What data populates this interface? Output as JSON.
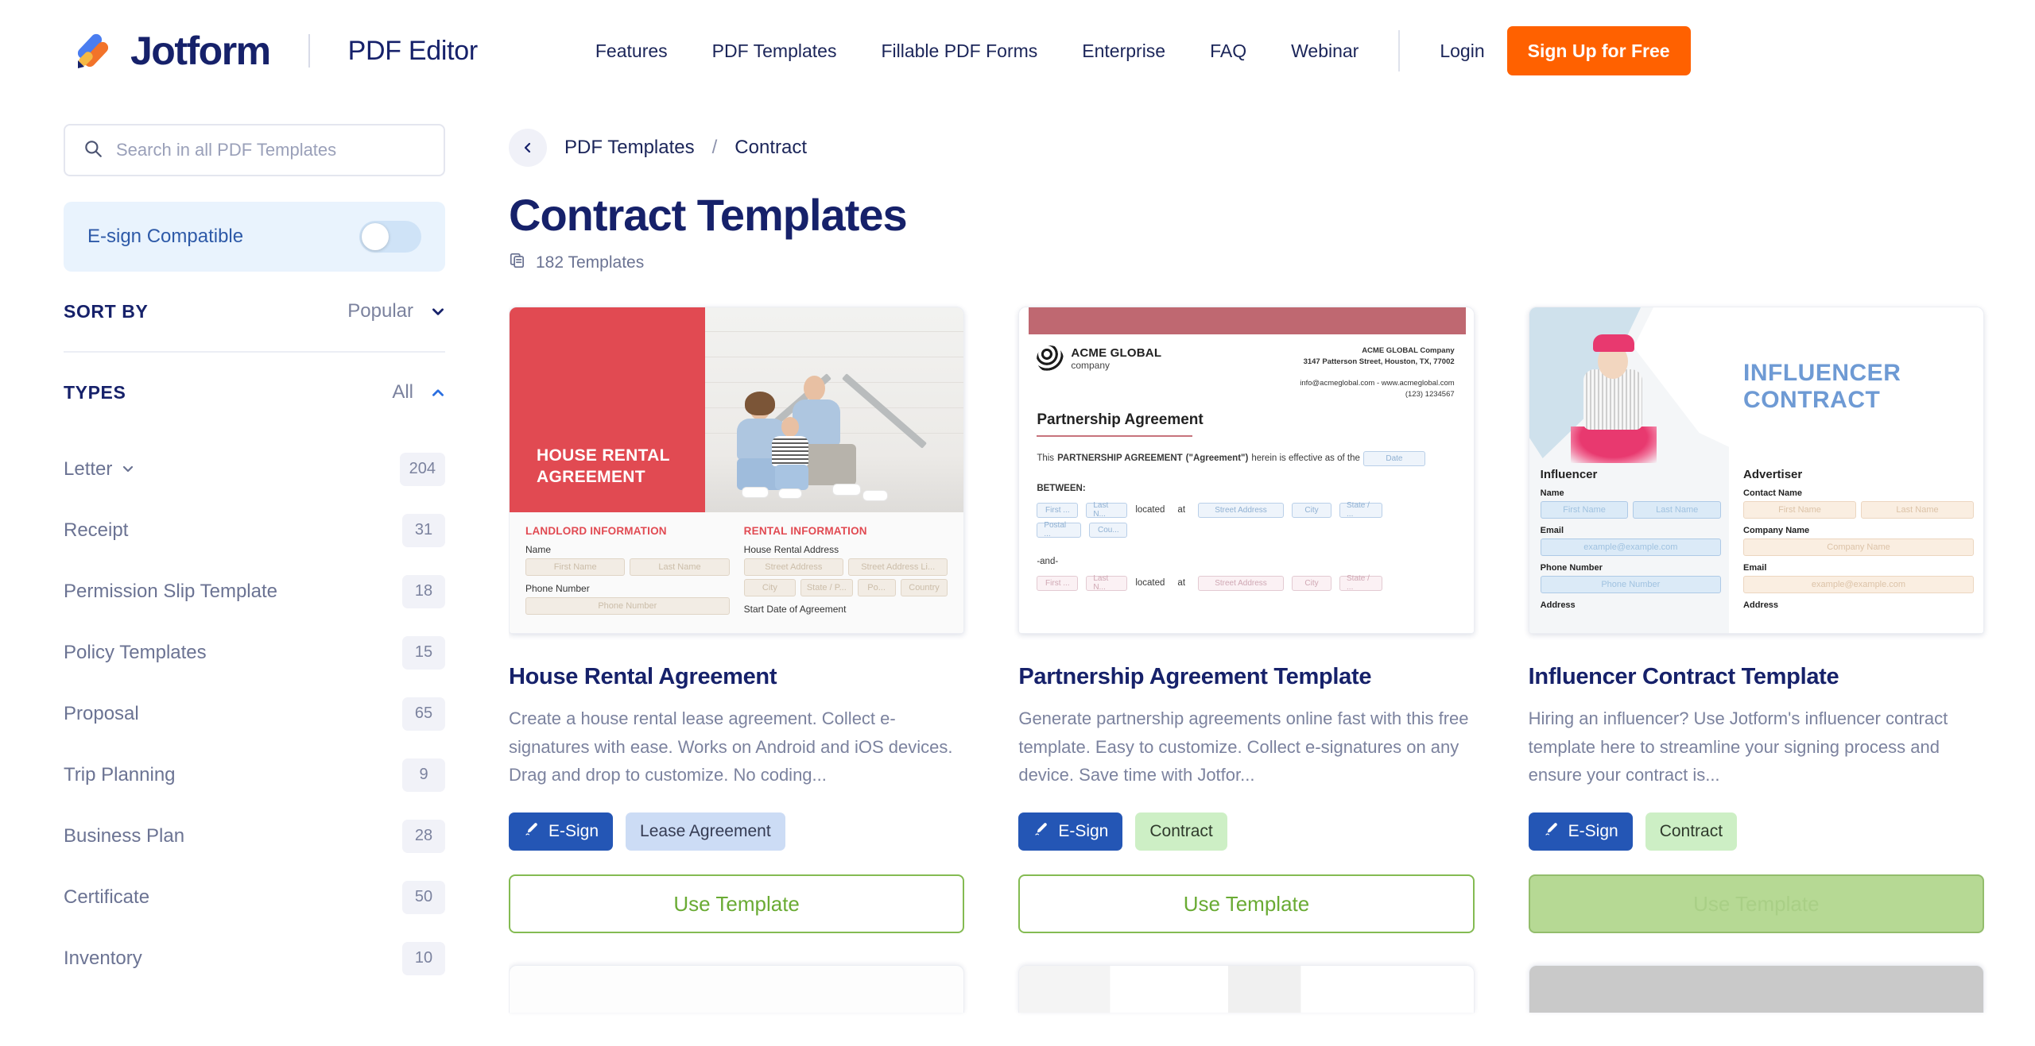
{
  "header": {
    "logo_text": "Jotform",
    "product_name": "PDF Editor",
    "nav": [
      {
        "label": "Features"
      },
      {
        "label": "PDF Templates"
      },
      {
        "label": "Fillable PDF Forms"
      },
      {
        "label": "Enterprise"
      },
      {
        "label": "FAQ"
      },
      {
        "label": "Webinar"
      }
    ],
    "login_label": "Login",
    "signup_label": "Sign Up for Free",
    "accent_orange": "#ff6100",
    "brand_navy": "#16216a"
  },
  "sidebar": {
    "search": {
      "placeholder": "Search in all PDF Templates",
      "value": ""
    },
    "esign": {
      "label": "E-sign Compatible",
      "enabled": false
    },
    "sort": {
      "title": "SORT BY",
      "value": "Popular"
    },
    "types": {
      "title": "TYPES",
      "value": "All"
    },
    "type_items": [
      {
        "label": "Letter",
        "count": "204",
        "has_caret": true
      },
      {
        "label": "Receipt",
        "count": "31",
        "has_caret": false
      },
      {
        "label": "Permission Slip Template",
        "count": "18",
        "has_caret": false
      },
      {
        "label": "Policy Templates",
        "count": "15",
        "has_caret": false
      },
      {
        "label": "Proposal",
        "count": "65",
        "has_caret": false
      },
      {
        "label": "Trip Planning",
        "count": "9",
        "has_caret": false
      },
      {
        "label": "Business Plan",
        "count": "28",
        "has_caret": false
      },
      {
        "label": "Certificate",
        "count": "50",
        "has_caret": false
      },
      {
        "label": "Inventory",
        "count": "10",
        "has_caret": false
      }
    ]
  },
  "main": {
    "breadcrumb": {
      "root": "PDF Templates",
      "separator": "/",
      "current": "Contract"
    },
    "title": "Contract Templates",
    "count_text": "182 Templates",
    "use_template_label": "Use Template",
    "esign_tag_label": "E-Sign",
    "cards": [
      {
        "title": "House Rental Agreement",
        "description": "Create a house rental lease agreement. Collect e-signatures with ease. Works on Android and iOS devices. Drag and drop to customize. No coding...",
        "tag": "Lease Agreement",
        "button_state": "normal",
        "thumb": {
          "hero_title": "HOUSE RENTAL AGREEMENT",
          "left_heading": "LANDLORD INFORMATION",
          "right_heading": "RENTAL INFORMATION",
          "left_fields": [
            {
              "label": "Name",
              "placeholders": [
                "First Name",
                "Last Name"
              ]
            },
            {
              "label": "Phone Number",
              "placeholders": [
                "Phone Number"
              ]
            }
          ],
          "right_fields": [
            {
              "label": "House Rental Address",
              "placeholders": [
                "Street Address",
                "Street Address Li..."
              ]
            },
            {
              "label": "",
              "placeholders": [
                "City",
                "State / P...",
                "Po...",
                "Country"
              ]
            },
            {
              "label": "Start Date of Agreement",
              "placeholders": []
            }
          ]
        }
      },
      {
        "title": "Partnership Agreement Template",
        "description": "Generate partnership agreements online fast with this free template. Easy to customize. Collect e-signatures on any device. Save time with Jotfor...",
        "tag": "Contract",
        "button_state": "normal",
        "thumb": {
          "company_name": "ACME GLOBAL",
          "company_sub": "company",
          "address_line1": "ACME GLOBAL Company",
          "address_line2": "3147 Patterson Street, Houston, TX, 77002",
          "address_line3": "info@acmeglobal.com - www.acmeglobal.com",
          "address_line4": "(123) 1234567",
          "doc_title": "Partnership Agreement",
          "para_prefix": "This",
          "para_bold": "PARTNERSHIP AGREEMENT",
          "para_quoted": "(\"Agreement\")",
          "para_mid": "herein is effective as of the",
          "date_placeholder": "Date",
          "between_label": "BETWEEN:",
          "and_label": "-and-",
          "party_fields": [
            "First ...",
            "Last N...",
            "Postal ...",
            "Cou..."
          ],
          "located_label": "located",
          "at_label": "at",
          "address_placeholders": [
            "Street Address",
            "City",
            "State / ..."
          ]
        }
      },
      {
        "title": "Influencer Contract Template",
        "description": "Hiring an influencer? Use Jotform's influencer contract template here to streamline your signing process and ensure your contract is...",
        "tag": "Contract",
        "button_state": "hover",
        "thumb": {
          "hero_line1": "INFLUENCER",
          "hero_line2": "CONTRACT",
          "left_section": "Influencer",
          "right_section": "Advertiser",
          "left_fields": [
            {
              "label": "Name",
              "placeholders": [
                "First Name",
                "Last Name"
              ]
            },
            {
              "label": "Email",
              "placeholders": [
                "example@example.com"
              ]
            },
            {
              "label": "Phone Number",
              "placeholders": [
                "Phone Number"
              ]
            },
            {
              "label": "Address",
              "placeholders": []
            }
          ],
          "right_fields": [
            {
              "label": "Contact Name",
              "placeholders": [
                "First Name",
                "Last Name"
              ]
            },
            {
              "label": "Company Name",
              "placeholders": [
                "Company Name"
              ]
            },
            {
              "label": "Email",
              "placeholders": [
                "example@example.com"
              ]
            },
            {
              "label": "Address",
              "placeholders": []
            }
          ]
        }
      }
    ]
  }
}
